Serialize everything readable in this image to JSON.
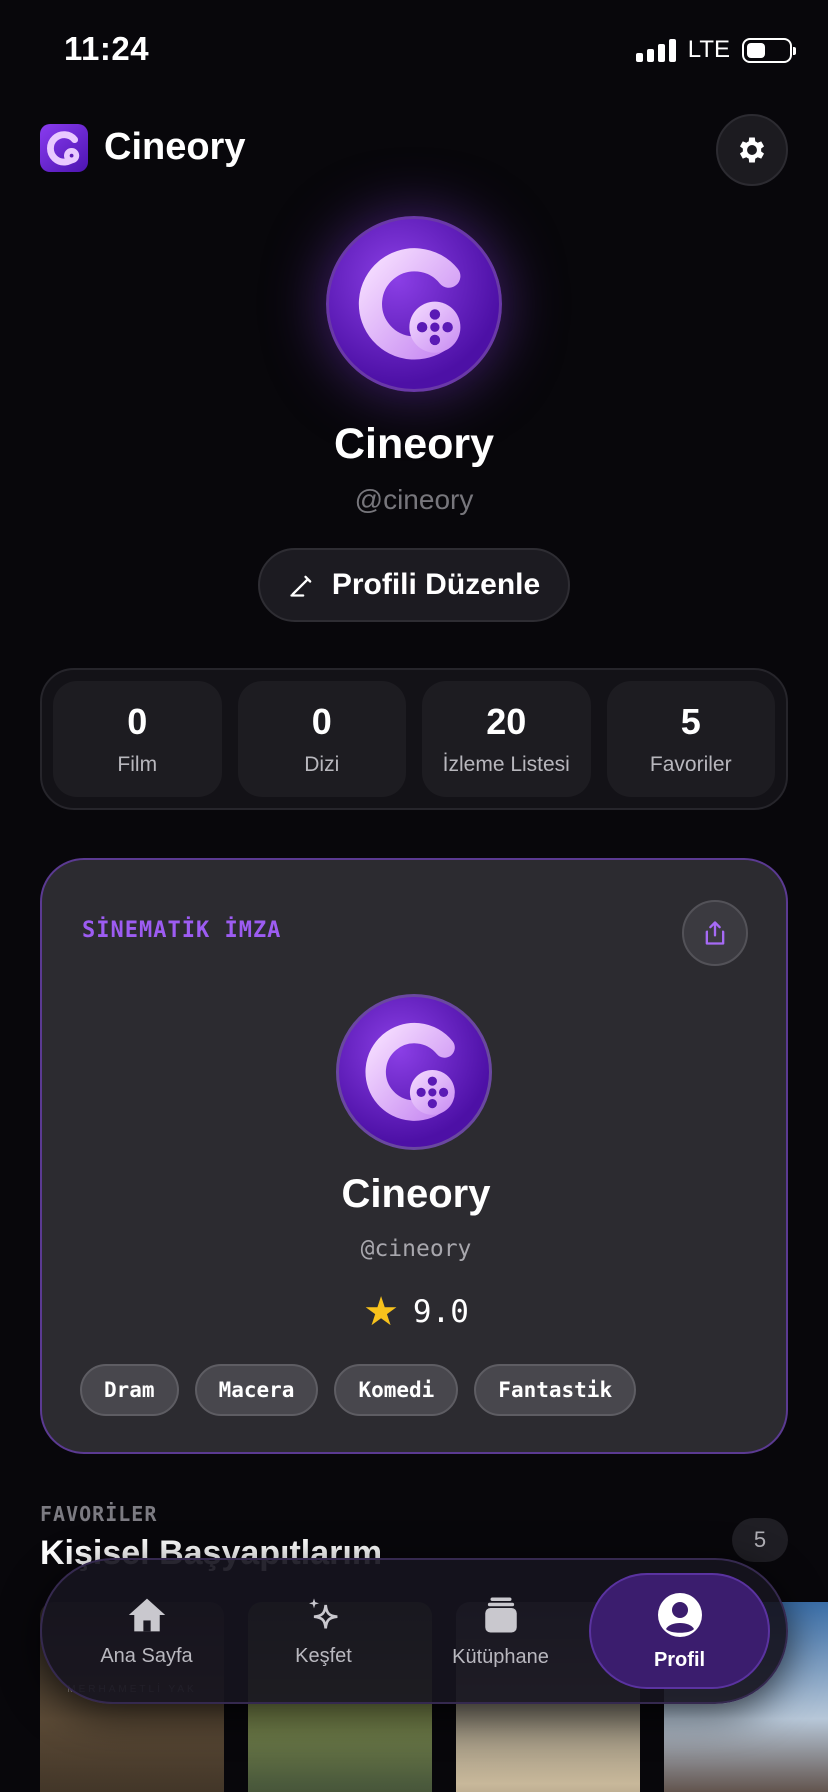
{
  "status_bar": {
    "time": "11:24",
    "network": "LTE"
  },
  "header": {
    "app_name": "Cineory"
  },
  "profile": {
    "name": "Cineory",
    "handle": "@cineory",
    "edit_label": "Profili Düzenle"
  },
  "stats": [
    {
      "value": "0",
      "label": "Film"
    },
    {
      "value": "0",
      "label": "Dizi"
    },
    {
      "value": "20",
      "label": "İzleme Listesi"
    },
    {
      "value": "5",
      "label": "Favoriler"
    }
  ],
  "signature": {
    "title": "SİNEMATİK İMZA",
    "name": "Cineory",
    "handle": "@cineory",
    "rating": "9.0",
    "genres": [
      "Dram",
      "Macera",
      "Komedi",
      "Fantastik"
    ]
  },
  "favorites": {
    "kicker": "FAVORİLER",
    "title": "Kişisel Başyapıtlarım",
    "count": "5",
    "poster_caption": "MERHAMETLİ YAK"
  },
  "tabbar": {
    "items": [
      {
        "label": "Ana Sayfa",
        "icon": "home-icon"
      },
      {
        "label": "Keşfet",
        "icon": "sparkle-icon"
      },
      {
        "label": "Kütüphane",
        "icon": "library-icon"
      },
      {
        "label": "Profil",
        "icon": "profile-icon",
        "active": true
      }
    ]
  },
  "colors": {
    "accent": "#9d5cf2",
    "background": "#08070b",
    "card": "#2c2b30",
    "star": "#f7c21c"
  }
}
